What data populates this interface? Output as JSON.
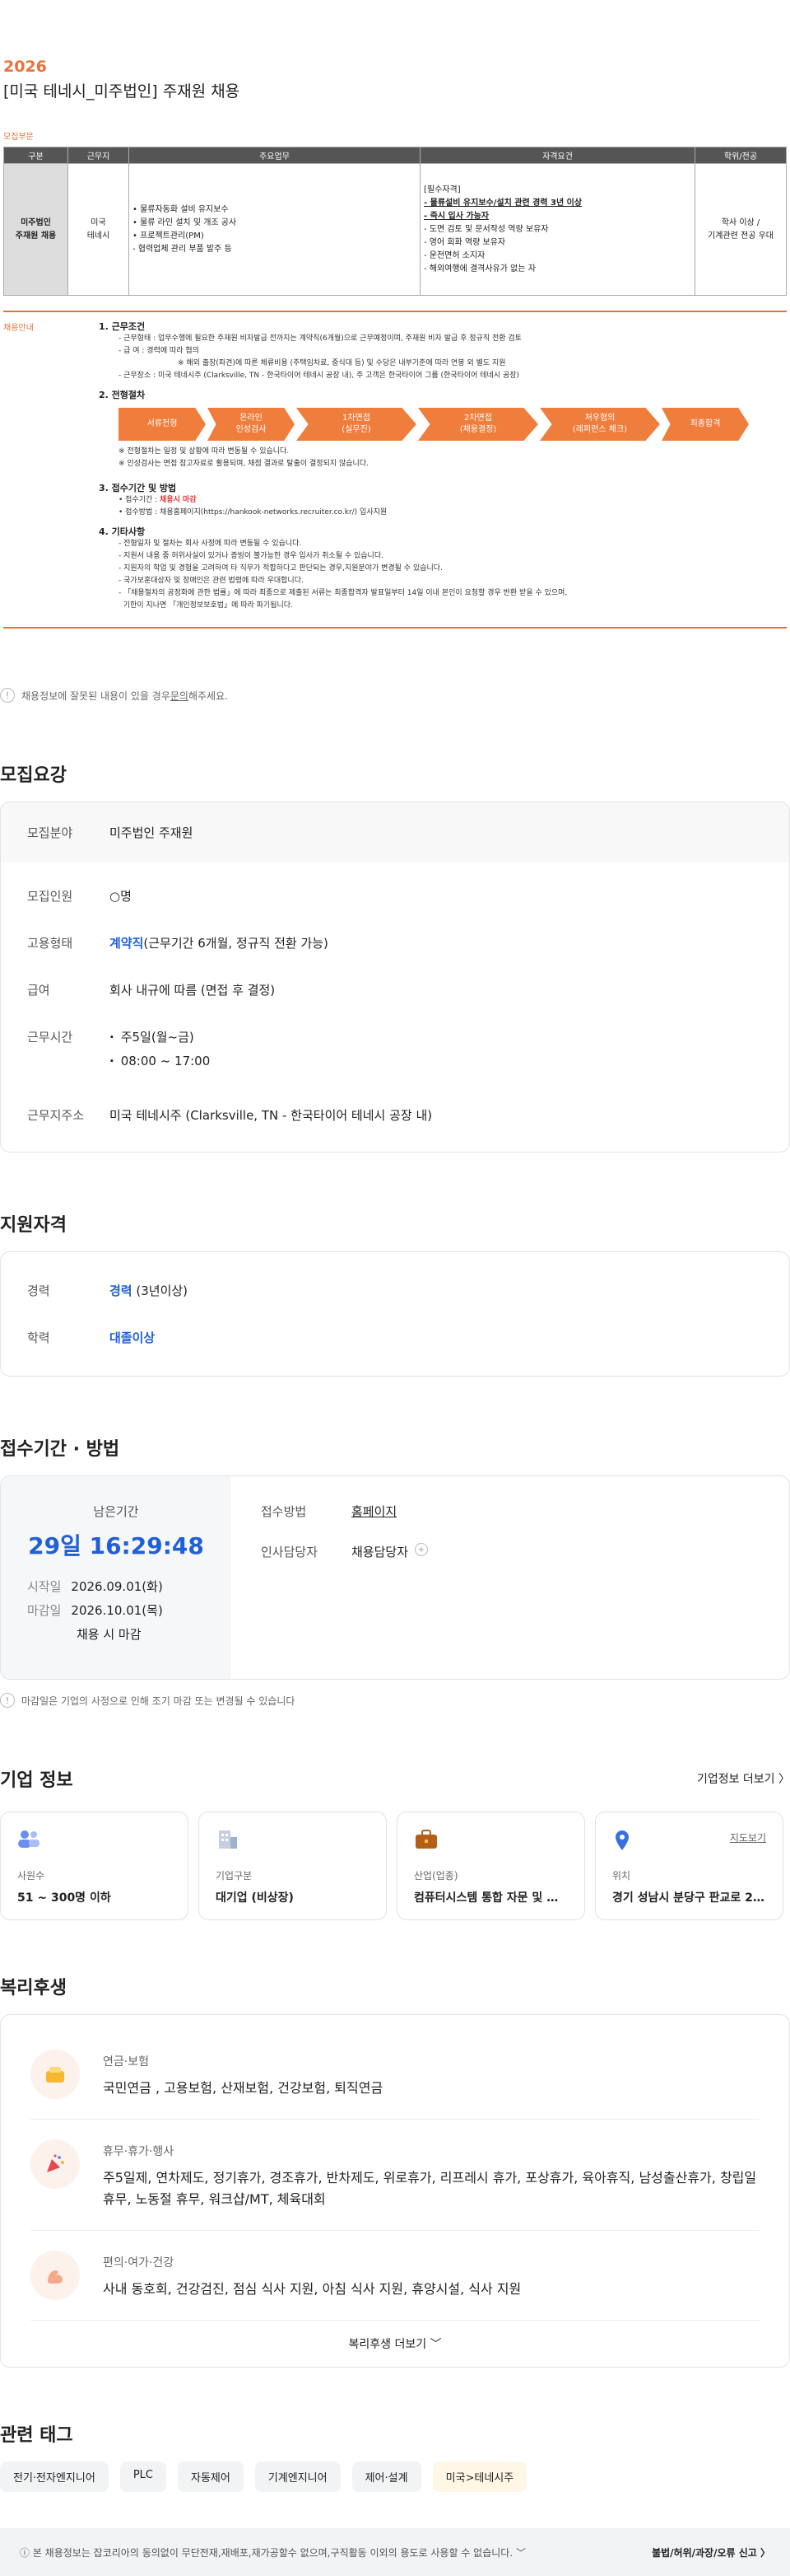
{
  "poster": {
    "year": "2026",
    "title": "[미국 테네시_미주법인] 주재원 채용",
    "section_label": "모집부문",
    "table_headers": [
      "구분",
      "근무지",
      "주요업무",
      "자격요건",
      "학위/전공"
    ],
    "row": {
      "gubun": "미주법인\n주재원 채용",
      "place": "미국\n테네시",
      "duties": [
        "• 물류자동화 설비 유지보수",
        "• 물류 라인 설치 및 개조 공사",
        "• 프로젝트관리(PM)",
        "- 협력업체 관리 부품 발주 등"
      ],
      "quals": [
        "[필수자격]",
        "- 물류설비 유지보수/설치 관련 경력 3년 이상",
        "- 즉시 입사 가능자",
        "- 도면 검토 및 문서작성 역량 보유자",
        "- 영어 회화 역량 보유자",
        "- 운전면허 소지자",
        "- 해외여행에 결격사유가 없는 자"
      ],
      "degree": "학사 이상 /\n기계관련 전공 우대"
    },
    "guide_label": "채용안내",
    "h1": "1. 근무조건",
    "c1": "- 근무형태 : 업무수행에 필요한 주재원 비자발급 전까지는 계약직(6개월)으로 근무예정이며, 주재원 비자 발급 후 정규직 전환 검토",
    "c2": "- 급      여 : 경력에 따라 협의",
    "c3": "※ 해외 출장(파견)에 따른 체류비용 (주택임차료, 중식대 등) 및 수당은 내부기준에 따라 연봉 외 별도 지원",
    "c4": "- 근무장소 : 미국 테네시주 (Clarksville, TN - 한국타이어 테네시 공장 내), 주 고객은 한국타이어 그룹 (한국타이어 테네시 공장)",
    "h2": "2. 전형절차",
    "steps": [
      "서류전형",
      "온라인\n인성검사",
      "1차면접\n(실무진)",
      "2차면접\n(채용결정)",
      "처우협의\n(레퍼런스 체크)",
      "최종합격"
    ],
    "s_note1": "※ 전형절차는 일정 및 상황에 따라 변동될 수 있습니다.",
    "s_note2": "※ 인성검사는 면접 참고자료로 활용되며, 채점 결과로 탈출이 결정되지 않습니다.",
    "h3": "3. 접수기간 및 방법",
    "a1_label": "• 접수기간 : ",
    "a1_value": "채용시 마감",
    "a2": "• 접수방법 : 채용홈페이지(https://hankook-networks.recruiter.co.kr/) 입사지원",
    "h4": "4. 기타사항",
    "e1": "- 전형일자 및 절차는 회사 사정에 따라 변동될 수 있습니다.",
    "e2": "- 지원서 내용 중 허위사실이 있거나 증빙이 불가능한 경우 입사가 취소될 수 있습니다.",
    "e3": "- 지원자의 학업 및 경험을 고려하여 타 직무가 적합하다고 판단되는 경우,지원분야가 변경될 수 있습니다.",
    "e4": "- 국가보훈대상자 및 장애인은 관련 법령에 따라 우대합니다.",
    "e5": "- 「채용절차의 공정화에 관한 법률」에 따라 최종으로 제출된 서류는 최종합격자 발표일부터 14일 이내    본인이 요청할 경우 반환 받을 수 있으며,",
    "e6": "  기한이 지나면 「개인정보보호법」에 따라 파기됩니다."
  },
  "report_note": "채용정보에 잘못된 내용이 있을 경우 ",
  "report_link": "문의",
  "report_tail": "해주세요.",
  "req": {
    "title": "모집요강",
    "rows": [
      {
        "k": "모집분야",
        "v": "미주법인 주재원"
      },
      {
        "k": "모집인원",
        "v": "○명"
      },
      {
        "k": "고용형태",
        "v1": "계약직",
        "v2": "(근무기간 6개월, 정규직 전환 가능)"
      },
      {
        "k": "급여",
        "v": "회사 내규에 따름 (면접 후 결정)"
      },
      {
        "k": "근무시간",
        "b1": "주5일(월~금)",
        "b2": "08:00 ~ 17:00"
      },
      {
        "k": "근무지주소",
        "v": "미국 테네시주 (Clarksville, TN - 한국타이어 테네시 공장 내)"
      }
    ]
  },
  "qual": {
    "title": "지원자격",
    "career_k": "경력",
    "career_v1": "경력",
    "career_v2": " (3년이상)",
    "edu_k": "학력",
    "edu_v": "대졸이상"
  },
  "apply": {
    "title": "접수기간 · 방법",
    "remain_label": "남은기간",
    "remain": "29일 16:29:48",
    "start_k": "시작일",
    "start_v": "2026.09.01(화)",
    "end_k": "마감일",
    "end_v": "2026.10.01(목)",
    "early": "채용 시 마감",
    "method_k": "접수방법",
    "method_v": "홈페이지",
    "hr_k": "인사담당자",
    "hr_v": "채용담당자"
  },
  "apply_note": "마감일은 기업의 사정으로 인해 조기 마감 또는 변경될 수 있습니다",
  "company": {
    "title": "기업 정보",
    "more": "기업정보 더보기 〉",
    "cards": [
      {
        "l": "사원수",
        "v": "51 ~ 300명 이하"
      },
      {
        "l": "기업구분",
        "v": "대기업 (비상장)"
      },
      {
        "l": "산업(업종)",
        "v": "컴퓨터시스템 통합 자문 및 구축 ..."
      },
      {
        "l": "위치",
        "v": "경기 성남시 분당구 판교로 286 ..."
      }
    ],
    "map": "지도보기"
  },
  "benefit": {
    "title": "복리후생",
    "items": [
      {
        "t": "연금·보험",
        "d": "국민연금 , 고용보험, 산재보험, 건강보험, 퇴직연금"
      },
      {
        "t": "휴무·휴가·행사",
        "d": "주5일제, 연차제도, 정기휴가, 경조휴가, 반차제도, 위로휴가, 리프레시 휴가, 포상휴가, 육아휴직, 남성출산휴가, 창립일 휴무, 노동절 휴무, 워크샵/MT, 체육대회"
      },
      {
        "t": "편의·여가·건강",
        "d": "사내 동호회, 건강검진, 점심 식사 지원, 아침 식사 지원, 휴양시설, 식사 지원"
      }
    ],
    "more": "복리후생 더보기 ﹀"
  },
  "tags": {
    "title": "관련 태그",
    "items": [
      "전기·전자엔지니어",
      "PLC",
      "자동제어",
      "기계엔지니어",
      "제어·설계",
      "미국>테네시주"
    ]
  },
  "footer": {
    "left": "ⓘ  본 채용정보는 잡코리아의 동의없이 무단전재,재배포,재가공할수 없으며,구직활동 이외의 용도로 사용할 수 없습니다.  ﹀",
    "right": "불법/허위/과장/오류 신고  〉"
  }
}
